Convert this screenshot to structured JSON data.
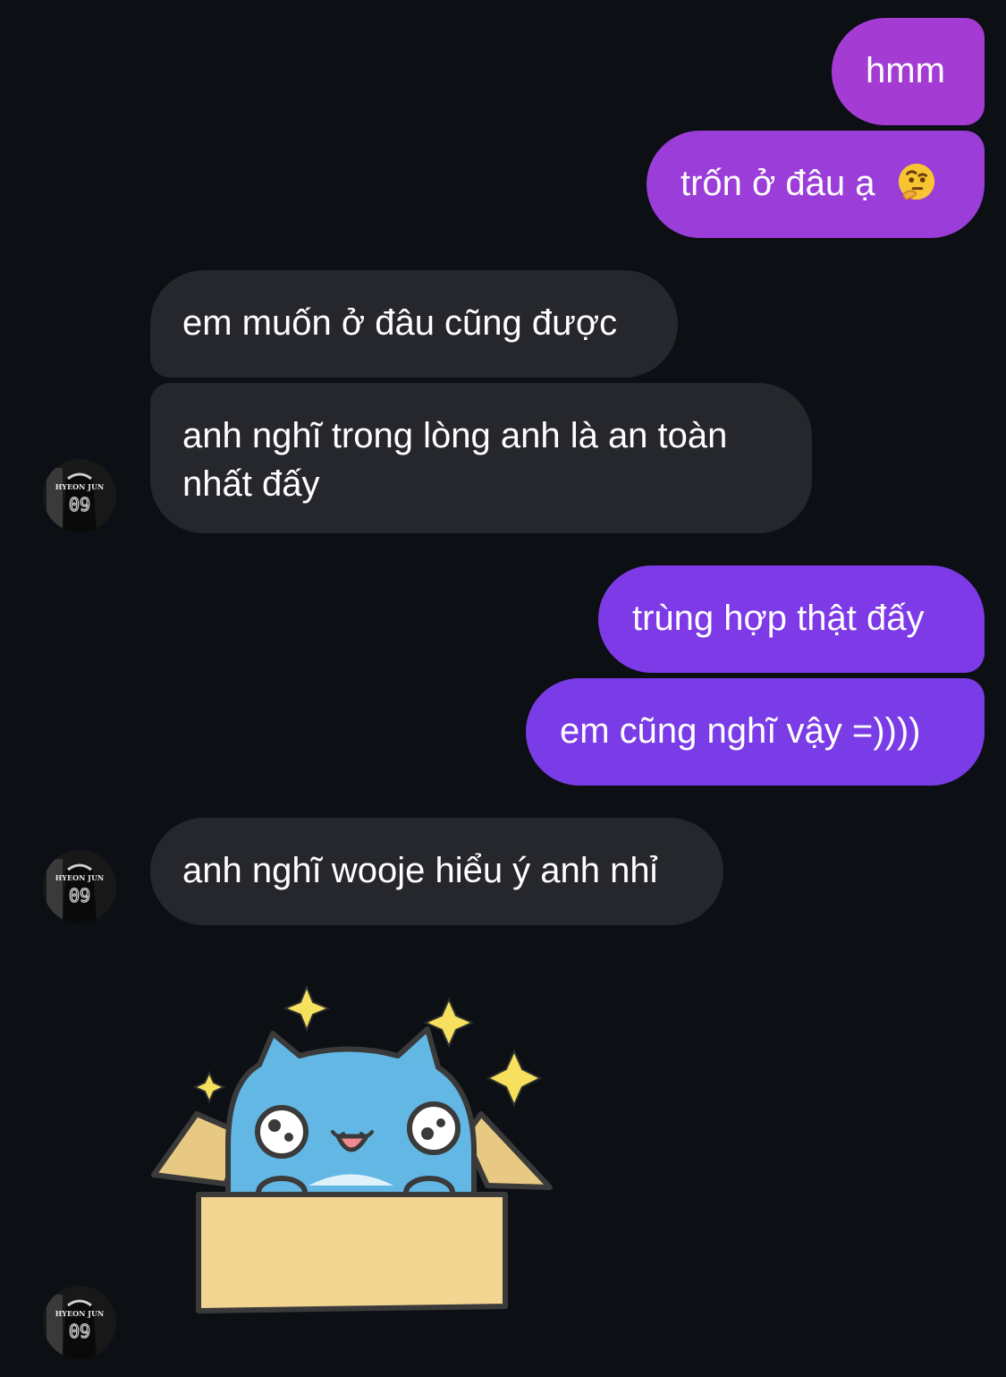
{
  "messages": {
    "m1": "hmm",
    "m2": "trốn ở đâu ạ",
    "m3": "em muốn ở đâu cũng được",
    "m4_line1": "anh nghĩ trong lòng anh là an toàn",
    "m4_line2": "nhất đấy",
    "m5": "trùng hợp thật đấy",
    "m6": "em cũng nghĩ vậy =))))",
    "m7": "anh nghĩ wooje hiểu ý anh nhỉ"
  },
  "avatar": {
    "jersey_name": "HYEON JUN",
    "jersey_number": "09"
  },
  "emoji": {
    "thinking": "thinking-face"
  },
  "colors": {
    "background": "#0c0f14",
    "incoming_bubble": "#25272c",
    "outgoing_top": "#a43cd4",
    "outgoing_bottom": "#7a3ce6",
    "text": "#ffffff"
  }
}
